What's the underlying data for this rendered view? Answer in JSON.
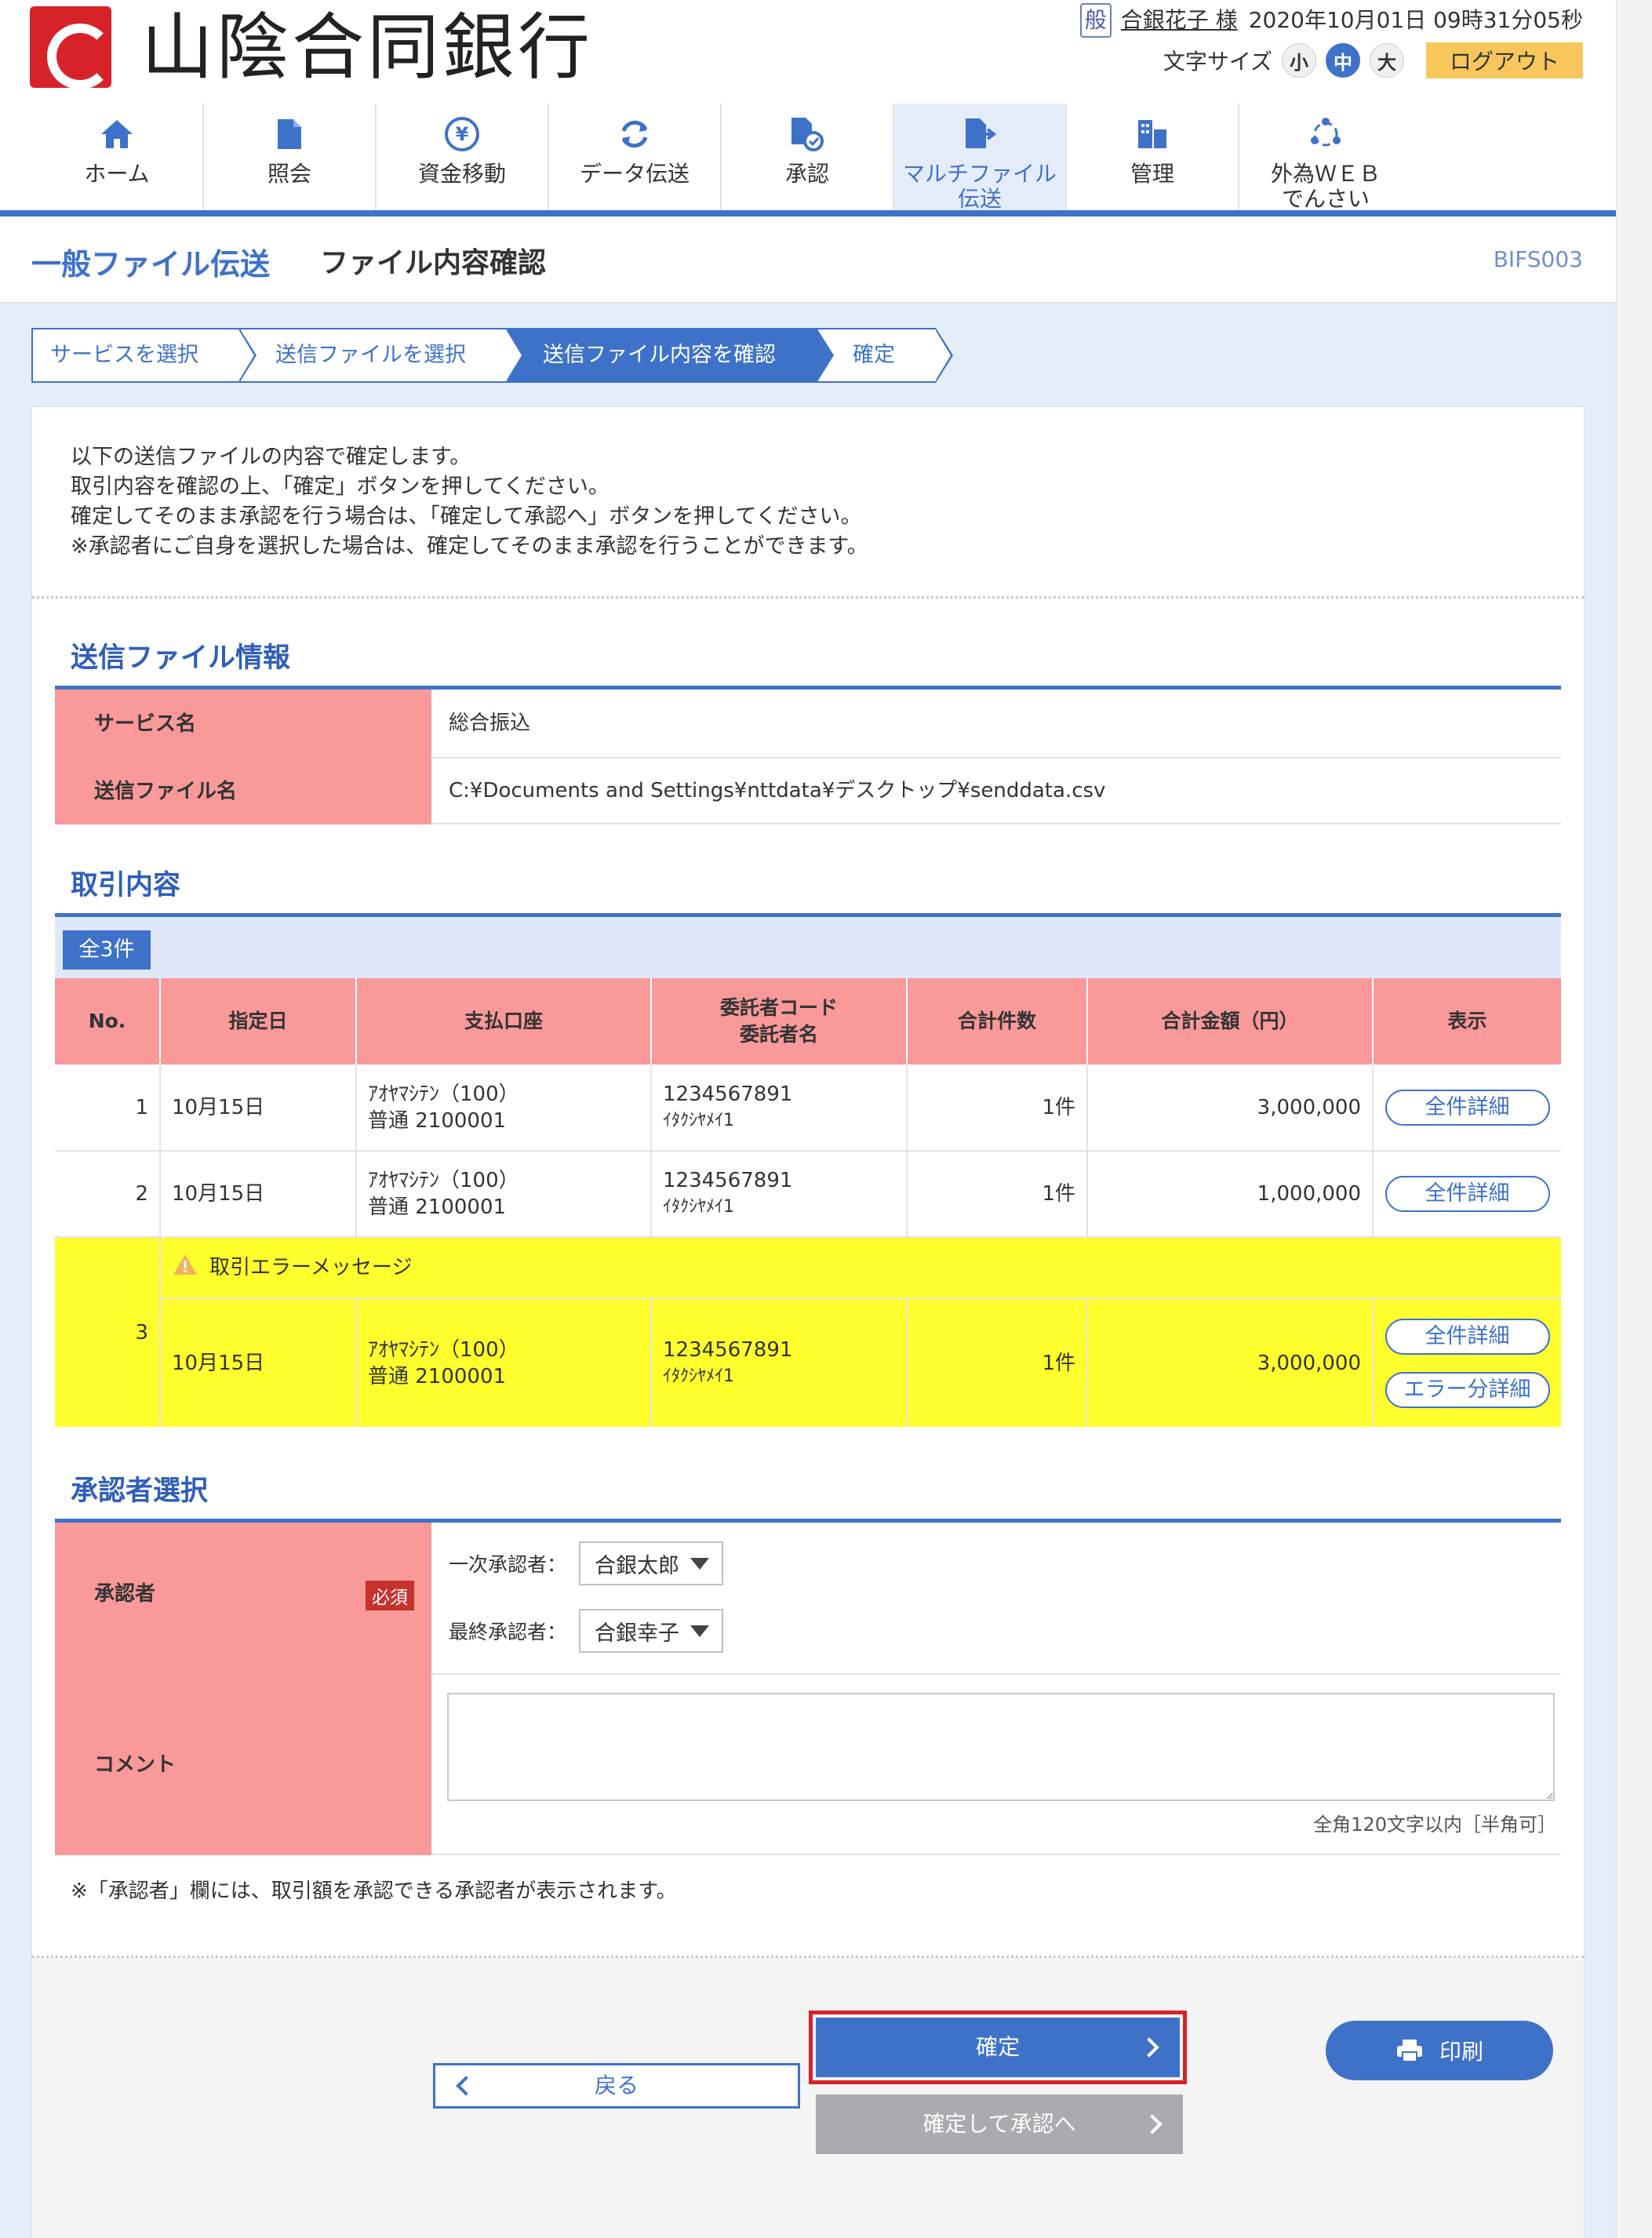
{
  "header": {
    "brand": "山陰合同銀行",
    "user_badge": "般",
    "user_name": "合銀花子 様",
    "datetime": "2020年10月01日 09時31分05秒",
    "font_size_label": "文字サイズ",
    "font_small": "小",
    "font_medium": "中",
    "font_large": "大",
    "logout": "ログアウト"
  },
  "nav": [
    {
      "label": "ホーム",
      "icon": "home-icon"
    },
    {
      "label": "照会",
      "icon": "document-icon"
    },
    {
      "label": "資金移動",
      "icon": "yen-icon"
    },
    {
      "label": "データ伝送",
      "icon": "refresh-icon"
    },
    {
      "label": "承認",
      "icon": "approve-icon"
    },
    {
      "label": "マルチファイル伝送",
      "icon": "multi-file-icon",
      "active": true
    },
    {
      "label": "管理",
      "icon": "building-icon"
    },
    {
      "label": "外為ＷＥＢでんさい",
      "icon": "network-icon"
    }
  ],
  "page": {
    "category": "一般ファイル伝送",
    "title": "ファイル内容確認",
    "screen_id": "BIFS003"
  },
  "steps": [
    "サービスを選択",
    "送信ファイルを選択",
    "送信ファイル内容を確認",
    "確定"
  ],
  "intro": [
    "以下の送信ファイルの内容で確定します。",
    "取引内容を確認の上、「確定」ボタンを押してください。",
    "確定してそのまま承認を行う場合は、「確定して承認へ」ボタンを押してください。",
    "※承認者にご自身を選択した場合は、確定してそのまま承認を行うことができます。"
  ],
  "file_info": {
    "heading": "送信ファイル情報",
    "service_label": "サービス名",
    "service_value": "総合振込",
    "file_label": "送信ファイル名",
    "file_value": "C:¥Documents and Settings¥nttdata¥デスクトップ¥senddata.csv"
  },
  "transactions": {
    "heading": "取引内容",
    "count": "全3件",
    "columns": [
      "No.",
      "指定日",
      "支払口座",
      "委託者コード",
      "委託者名",
      "合計件数",
      "合計金額（円）",
      "表示"
    ],
    "rows": [
      {
        "no": "1",
        "date": "10月15日",
        "account1": "ｱｵﾔﾏｼﾃﾝ（100）",
        "account2": "普通 2100001",
        "code": "1234567891",
        "name": "ｲﾀｸｼﾔﾒｲ1",
        "count": "1件",
        "amount": "3,000,000",
        "detail": "全件詳細"
      },
      {
        "no": "2",
        "date": "10月15日",
        "account1": "ｱｵﾔﾏｼﾃﾝ（100）",
        "account2": "普通 2100001",
        "code": "1234567891",
        "name": "ｲﾀｸｼﾔﾒｲ1",
        "count": "1件",
        "amount": "1,000,000",
        "detail": "全件詳細"
      },
      {
        "no": "3",
        "date": "10月15日",
        "account1": "ｱｵﾔﾏｼﾃﾝ（100）",
        "account2": "普通 2100001",
        "code": "1234567891",
        "name": "ｲﾀｸｼﾔﾒｲ1",
        "count": "1件",
        "amount": "3,000,000",
        "detail": "全件詳細",
        "error_detail": "エラー分詳細",
        "error_message": "取引エラーメッセージ"
      }
    ]
  },
  "approver": {
    "heading": "承認者選択",
    "label": "承認者",
    "required": "必須",
    "first_label": "一次承認者：",
    "first_value": "合銀太郎",
    "final_label": "最終承認者：",
    "final_value": "合銀幸子",
    "comment_label": "コメント",
    "comment_value": "",
    "comment_hint": "全角120文字以内［半角可］",
    "note": "※「承認者」欄には、取引額を承認できる承認者が表示されます。"
  },
  "buttons": {
    "confirm": "確定",
    "confirm_approve": "確定して承認へ",
    "back": "戻る",
    "print": "印刷"
  },
  "colors": {
    "accent": "#3e72c9",
    "header_cell": "#f9999a",
    "error_row": "#ffff2e",
    "logout": "#f7c75b",
    "brand_red": "#d8222a"
  }
}
